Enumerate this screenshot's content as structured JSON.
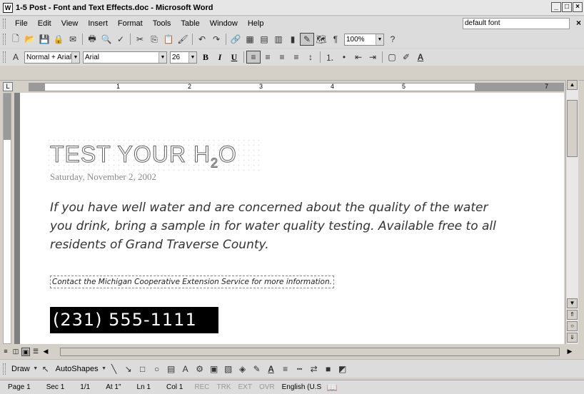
{
  "window": {
    "title": "1-5 Post - Font and Text Effects.doc - Microsoft Word",
    "app_icon": "W",
    "min": "_",
    "max": "□",
    "close": "×"
  },
  "menubar": {
    "items": [
      "File",
      "Edit",
      "View",
      "Insert",
      "Format",
      "Tools",
      "Table",
      "Window",
      "Help"
    ],
    "font_box": "default font",
    "close_doc": "×"
  },
  "standard_toolbar": {
    "zoom": "100%"
  },
  "format_toolbar": {
    "style": "Normal + Arial,",
    "font": "Arial",
    "size": "26",
    "bold": "B",
    "italic": "I",
    "underline": "U"
  },
  "ruler": {
    "marks": [
      "1",
      "2",
      "3",
      "4",
      "5",
      "7"
    ]
  },
  "document": {
    "headline": "TEST YOUR H",
    "headline_sub": "2",
    "headline_tail": "O",
    "date": "Saturday, November 2, 2002",
    "body": "If you have well water and are concerned about the quality of the water you drink, bring a sample in for water quality testing. Available free to all residents of Grand Traverse County.",
    "contact": "Contact the Michigan Cooperative Extension Service for more information.",
    "phone": "(231) 555-1111"
  },
  "drawbar": {
    "draw": "Draw",
    "autoshapes": "AutoShapes"
  },
  "status": {
    "page": "Page 1",
    "sec": "Sec 1",
    "pages": "1/1",
    "at": "At 1\"",
    "ln": "Ln 1",
    "col": "Col 1",
    "rec": "REC",
    "trk": "TRK",
    "ext": "EXT",
    "ovr": "OVR",
    "lang": "English (U.S"
  },
  "colors": {
    "phone_bg": "#000000",
    "headline_outline": "#666666"
  }
}
